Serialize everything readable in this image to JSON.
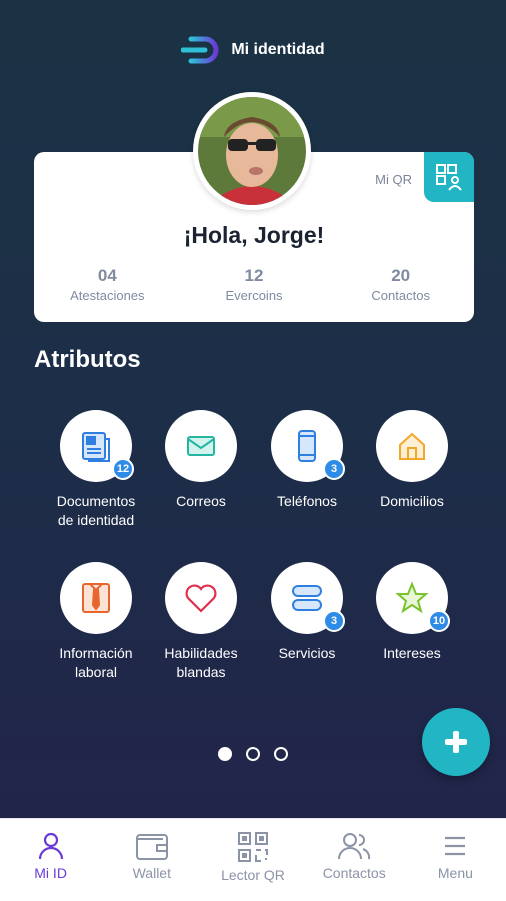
{
  "header": {
    "title": "Mi identidad"
  },
  "profile": {
    "qr_label": "Mi QR",
    "greeting": "¡Hola, Jorge!",
    "stats": [
      {
        "value": "04",
        "label": "Atestaciones"
      },
      {
        "value": "12",
        "label": "Evercoins"
      },
      {
        "value": "20",
        "label": "Contactos"
      }
    ]
  },
  "attributes": {
    "title": "Atributos",
    "items": [
      {
        "label_line1": "Documentos",
        "label_line2": "de identidad",
        "badge": "12",
        "icon": "document-icon"
      },
      {
        "label_line1": "Correos",
        "label_line2": "",
        "badge": "",
        "icon": "mail-icon"
      },
      {
        "label_line1": "Teléfonos",
        "label_line2": "",
        "badge": "3",
        "icon": "phone-icon"
      },
      {
        "label_line1": "Domicilios",
        "label_line2": "",
        "badge": "",
        "icon": "home-icon"
      },
      {
        "label_line1": "Información",
        "label_line2": "laboral",
        "badge": "",
        "icon": "shirt-tie-icon"
      },
      {
        "label_line1": "Habilidades",
        "label_line2": "blandas",
        "badge": "",
        "icon": "heart-icon"
      },
      {
        "label_line1": "Servicios",
        "label_line2": "",
        "badge": "3",
        "icon": "server-icon"
      },
      {
        "label_line1": "Intereses",
        "label_line2": "",
        "badge": "10",
        "icon": "star-icon"
      }
    ]
  },
  "pagination": {
    "pages": 3,
    "active": 1
  },
  "nav": {
    "items": [
      {
        "label": "Mi ID",
        "icon": "user-icon",
        "active": true
      },
      {
        "label": "Wallet",
        "icon": "wallet-icon",
        "active": false
      },
      {
        "label": "Lector QR",
        "icon": "qr-icon",
        "active": false
      },
      {
        "label": "Contactos",
        "icon": "contacts-icon",
        "active": false
      },
      {
        "label": "Menu",
        "icon": "menu-icon",
        "active": false
      }
    ]
  },
  "colors": {
    "accent": "#22b5c4",
    "active_nav": "#6b3ad6",
    "badge": "#2f8ce6"
  }
}
